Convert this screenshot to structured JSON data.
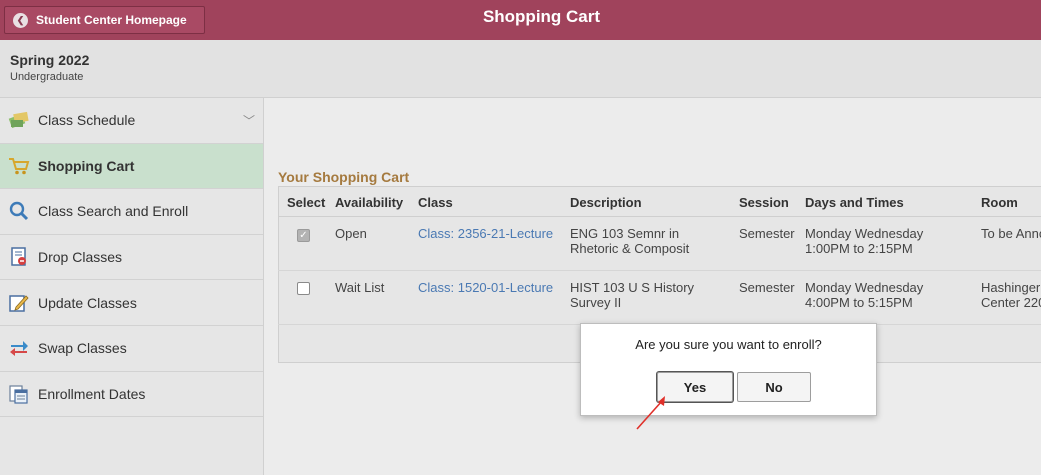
{
  "header": {
    "back_label": "Student Center Homepage",
    "title": "Shopping Cart"
  },
  "term": {
    "name": "Spring 2022",
    "career": "Undergraduate"
  },
  "sidebar": {
    "items": [
      {
        "label": "Class Schedule",
        "icon": "class-schedule-icon",
        "active": false
      },
      {
        "label": "Shopping Cart",
        "icon": "cart-icon",
        "active": true
      },
      {
        "label": "Class Search and Enroll",
        "icon": "search-icon",
        "active": false
      },
      {
        "label": "Drop Classes",
        "icon": "drop-icon",
        "active": false
      },
      {
        "label": "Update Classes",
        "icon": "edit-icon",
        "active": false
      },
      {
        "label": "Swap Classes",
        "icon": "swap-arrows-icon",
        "active": false
      },
      {
        "label": "Enrollment Dates",
        "icon": "calendar-icon",
        "active": false
      }
    ]
  },
  "cart": {
    "title": "Your Shopping Cart",
    "columns": [
      "Select",
      "Availability",
      "Class",
      "Description",
      "Session",
      "Days and Times",
      "Room"
    ],
    "rows": [
      {
        "checked": true,
        "availability": "Open",
        "class": "Class: 2356-21-Lecture",
        "description_1": "ENG 103 Semnr in",
        "description_2": "Rhetoric & Composit",
        "session": "Semester",
        "days": "Monday Wednesday",
        "times": "1:00PM to 2:15PM",
        "room_1": "To be Annc",
        "room_2": ""
      },
      {
        "checked": false,
        "availability": "Wait List",
        "class": "Class: 1520-01-Lecture",
        "description_1": "HIST 103 U S History",
        "description_2": "Survey II",
        "session": "Semester",
        "days": "Monday Wednesday",
        "times": "4:00PM to 5:15PM",
        "room_1": "Hashinger",
        "room_2": "Center 220"
      }
    ]
  },
  "dialog": {
    "message": "Are you sure you want to enroll?",
    "yes_label": "Yes",
    "no_label": "No"
  },
  "colors": {
    "header": "#a0435c",
    "active_nav": "#c9e0cd",
    "link": "#4a79b3",
    "cart_title": "#a57a3f",
    "annotation_arrow": "#e0302a"
  }
}
